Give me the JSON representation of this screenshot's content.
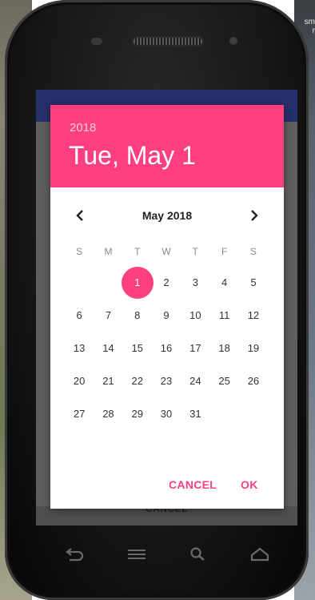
{
  "desktop": {
    "corner_text": "sm\nr"
  },
  "dialog": {
    "year": "2018",
    "date_title": "Tue, May 1",
    "month_label": "May 2018",
    "weekdays": [
      "S",
      "M",
      "T",
      "W",
      "T",
      "F",
      "S"
    ],
    "weeks": [
      [
        "",
        "",
        "1",
        "2",
        "3",
        "4",
        "5"
      ],
      [
        "6",
        "7",
        "8",
        "9",
        "10",
        "11",
        "12"
      ],
      [
        "13",
        "14",
        "15",
        "16",
        "17",
        "18",
        "19"
      ],
      [
        "20",
        "21",
        "22",
        "23",
        "24",
        "25",
        "26"
      ],
      [
        "27",
        "28",
        "29",
        "30",
        "31",
        "",
        ""
      ]
    ],
    "selected_day": "1",
    "cancel_label": "CANCEL",
    "ok_label": "OK"
  },
  "background_app": {
    "cancel_label": "CANCEL"
  },
  "icons": {
    "prev": "chevron-left-icon",
    "next": "chevron-right-icon",
    "back": "back-icon",
    "menu": "menu-icon",
    "search": "search-icon",
    "home": "home-icon"
  },
  "colors": {
    "accent": "#ff3f80",
    "app_bar": "#26306b"
  }
}
